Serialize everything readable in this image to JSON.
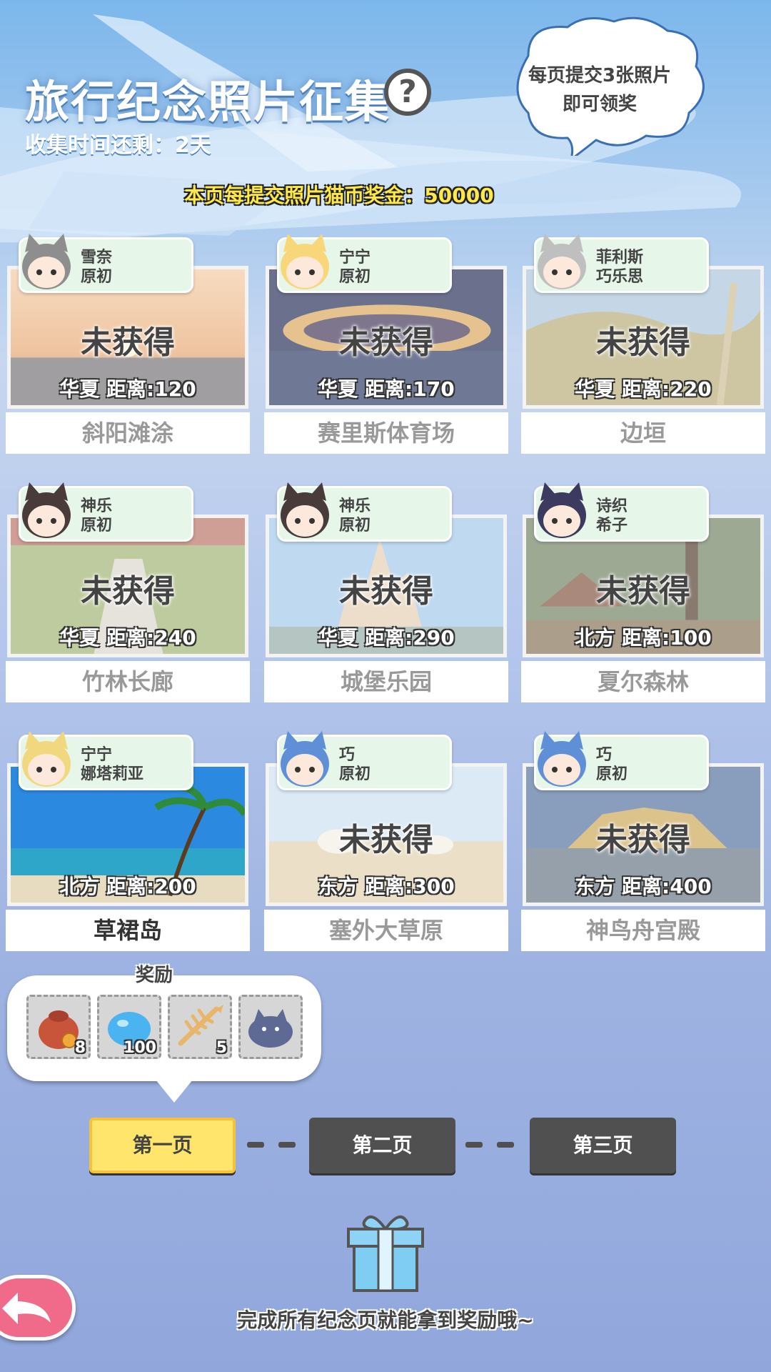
{
  "header": {
    "title": "旅行纪念照片征集",
    "time_left": "收集时间还剩：2天",
    "reward_line": "本页每提交照片猫币奖金：50000",
    "bubble_text_1": "每页提交3张照片",
    "bubble_text_2": "即可领奖"
  },
  "cards": [
    {
      "tag_line1": "雪奈",
      "tag_line2": "原初",
      "status": "未获得",
      "distance": "华夏  距离:120",
      "name": "斜阳滩涂",
      "owned": false
    },
    {
      "tag_line1": "宁宁",
      "tag_line2": "原初",
      "status": "未获得",
      "distance": "华夏  距离:170",
      "name": "赛里斯体育场",
      "owned": false
    },
    {
      "tag_line1": "菲利斯",
      "tag_line2": "巧乐思",
      "status": "未获得",
      "distance": "华夏  距离:220",
      "name": "边垣",
      "owned": false
    },
    {
      "tag_line1": "神乐",
      "tag_line2": "原初",
      "status": "未获得",
      "distance": "华夏  距离:240",
      "name": "竹林长廊",
      "owned": false
    },
    {
      "tag_line1": "神乐",
      "tag_line2": "原初",
      "status": "未获得",
      "distance": "华夏  距离:290",
      "name": "城堡乐园",
      "owned": false
    },
    {
      "tag_line1": "诗织",
      "tag_line2": "希子",
      "status": "未获得",
      "distance": "北方  距离:100",
      "name": "夏尔森林",
      "owned": false
    },
    {
      "tag_line1": "宁宁",
      "tag_line2": "娜塔莉亚",
      "status": "",
      "distance": "北方  距离:200",
      "name": "草裙岛",
      "owned": true
    },
    {
      "tag_line1": "巧",
      "tag_line2": "原初",
      "status": "未获得",
      "distance": "东方  距离:300",
      "name": "塞外大草原",
      "owned": false
    },
    {
      "tag_line1": "巧",
      "tag_line2": "原初",
      "status": "未获得",
      "distance": "东方  距离:400",
      "name": "神鸟舟宫殿",
      "owned": false
    }
  ],
  "rewards": {
    "title": "奖励",
    "items": [
      {
        "icon": "coin-bag-icon",
        "count": "8"
      },
      {
        "icon": "blue-blob-icon",
        "count": "100"
      },
      {
        "icon": "fish-bone-icon",
        "count": "5"
      },
      {
        "icon": "cat-blob-icon",
        "count": ""
      }
    ]
  },
  "pages": [
    "第一页",
    "第二页",
    "第三页"
  ],
  "active_page": 0,
  "footer_text": "完成所有纪念页就能拿到奖励哦~",
  "icons": {
    "help": "help-icon",
    "gift": "gift-icon",
    "back": "back-arrow-icon"
  },
  "help_symbol": "?",
  "colors": {
    "active_page": "#ffe56b",
    "inactive_page": "#505050",
    "reward_text": "#ffe94a",
    "back_button": "#f06a8a"
  }
}
